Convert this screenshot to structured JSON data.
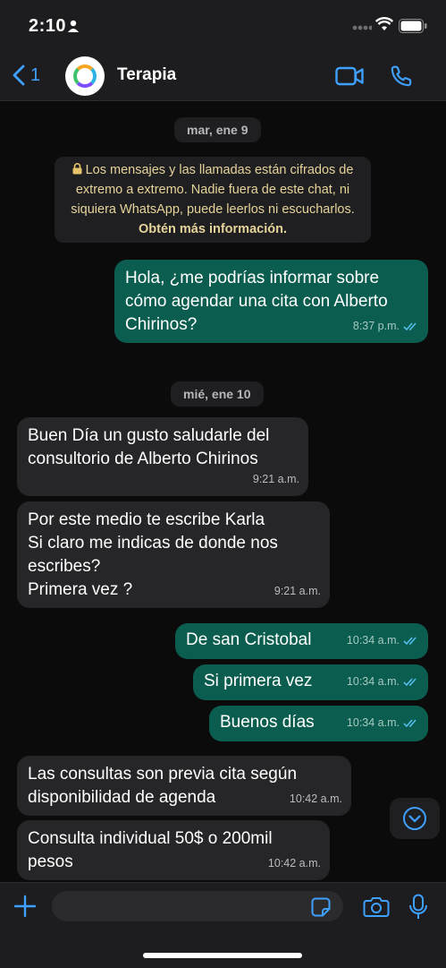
{
  "status_bar": {
    "time": "2:10"
  },
  "header": {
    "back_count": "1",
    "title": "Terapia"
  },
  "chat": {
    "date_1": "mar, ene 9",
    "encryption_notice": "Los mensajes y las llamadas están cifrados de extremo a extremo. Nadie fuera de este chat, ni siquiera WhatsApp, puede leerlos ni escucharlos.",
    "encryption_link": "Obtén más información.",
    "date_2": "mié, ene 10",
    "messages": [
      {
        "dir": "out",
        "text": "Hola, ¿me podrías informar sobre cómo agendar una cita con Alberto Chirinos?",
        "time": "8:37 p.m."
      },
      {
        "dir": "in",
        "text": "Buen Día un gusto saludarle del consultorio de Alberto Chirinos",
        "time": "9:21 a.m."
      },
      {
        "dir": "in",
        "text": "Por este medio te escribe Karla\nSi claro me indicas de donde nos escribes?\nPrimera vez ?",
        "time": "9:21 a.m."
      },
      {
        "dir": "out",
        "text": "De san Cristobal",
        "time": "10:34 a.m."
      },
      {
        "dir": "out",
        "text": "Si primera vez",
        "time": "10:34 a.m."
      },
      {
        "dir": "out",
        "text": "Buenos días",
        "time": "10:34 a.m."
      },
      {
        "dir": "in",
        "text": "Las consultas son previa cita según disponibilidad de agenda",
        "time": "10:42 a.m."
      },
      {
        "dir": "in",
        "text": "Consulta individual 50$ o 200mil pesos",
        "time": "10:42 a.m."
      }
    ]
  },
  "colors": {
    "accent": "#3ea0ff",
    "outgoing": "#0b5e4f",
    "incoming": "#262628",
    "read_ticks": "#53bdeb"
  }
}
